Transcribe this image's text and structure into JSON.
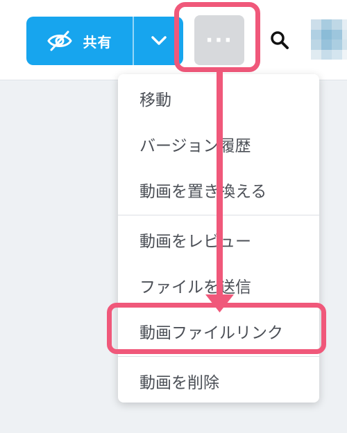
{
  "toolbar": {
    "share_label": "共有",
    "more_label": "···"
  },
  "menu": {
    "items": [
      "移動",
      "バージョン履歴",
      "動画を置き換える",
      "動画をレビュー",
      "ファイルを送信",
      "動画ファイルリンク",
      "動画を削除"
    ]
  },
  "icons": {
    "share": "eye-slash-icon",
    "caret": "chevron-down-icon",
    "search": "search-icon"
  },
  "colors": {
    "accent": "#17a5ee",
    "highlight": "#f0587a",
    "more_bg": "#d7d9dc"
  }
}
